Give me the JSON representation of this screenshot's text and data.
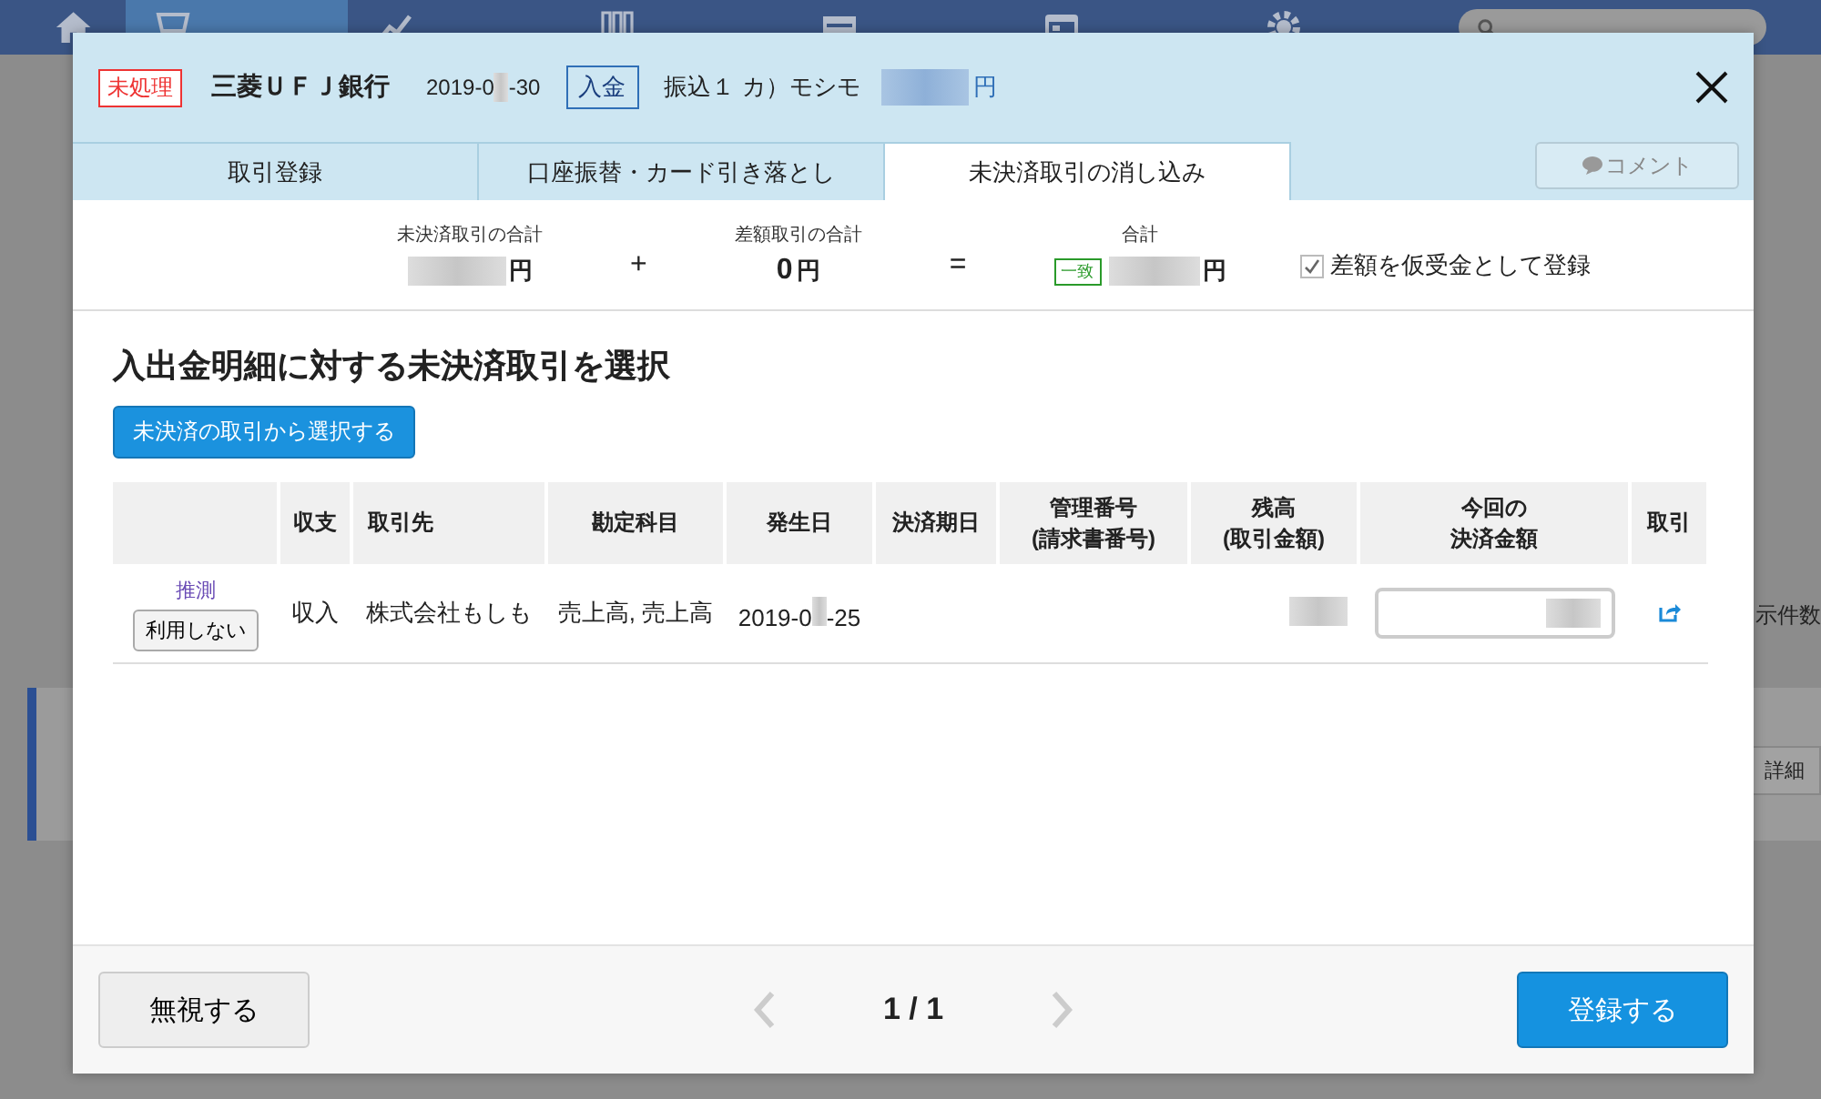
{
  "nav": {
    "items": [
      {
        "selected": true
      },
      {
        "selected": false
      },
      {
        "selected": false
      },
      {
        "selected": false
      },
      {
        "selected": false
      },
      {
        "selected": false
      }
    ]
  },
  "background": {
    "count_label": "示件数",
    "detail_button": "詳細"
  },
  "modal": {
    "status": "未処理",
    "bank": "三菱ＵＦＪ銀行",
    "date_start": "2019-0",
    "date_end": "-30",
    "direction": "入金",
    "description": "振込１ カ）モシモ",
    "amount_unit": "円",
    "tabs": [
      {
        "label": "取引登録",
        "selected": false
      },
      {
        "label": "口座振替・カード引き落とし",
        "selected": false
      },
      {
        "label": "未決済取引の消し込み",
        "selected": true
      }
    ],
    "comment_button": "コメント",
    "summary": {
      "unsettled": {
        "label": "未決済取引の合計",
        "unit": "円"
      },
      "plus": "+",
      "difference": {
        "label": "差額取引の合計",
        "value": "0",
        "unit": "円"
      },
      "equals": "=",
      "total": {
        "label": "合計",
        "badge": "一致",
        "unit": "円"
      },
      "checkbox": {
        "label": "差額を仮受金として登録",
        "checked": true
      }
    },
    "section_title": "入出金明細に対する未決済取引を選択",
    "select_button": "未決済の取引から選択する",
    "table": {
      "columns": [
        [
          "収支"
        ],
        [
          "取引先"
        ],
        [
          "勘定科目"
        ],
        [
          "発生日"
        ],
        [
          "決済期日"
        ],
        [
          "管理番号",
          "(請求書番号)"
        ],
        [
          "残高",
          "(取引金額)"
        ],
        [
          "今回の",
          "決済金額"
        ],
        [
          "取引"
        ]
      ],
      "rows": [
        {
          "guess_label": "推測",
          "unuse_button": "利用しない",
          "type": "収入",
          "partner": "株式会社もしも",
          "account": "売上高, 売上高",
          "date_start": "2019-0",
          "date_end": "-25"
        }
      ]
    },
    "footer": {
      "ignore_button": "無視する",
      "pager": "1 / 1",
      "register_button": "登録する"
    }
  }
}
